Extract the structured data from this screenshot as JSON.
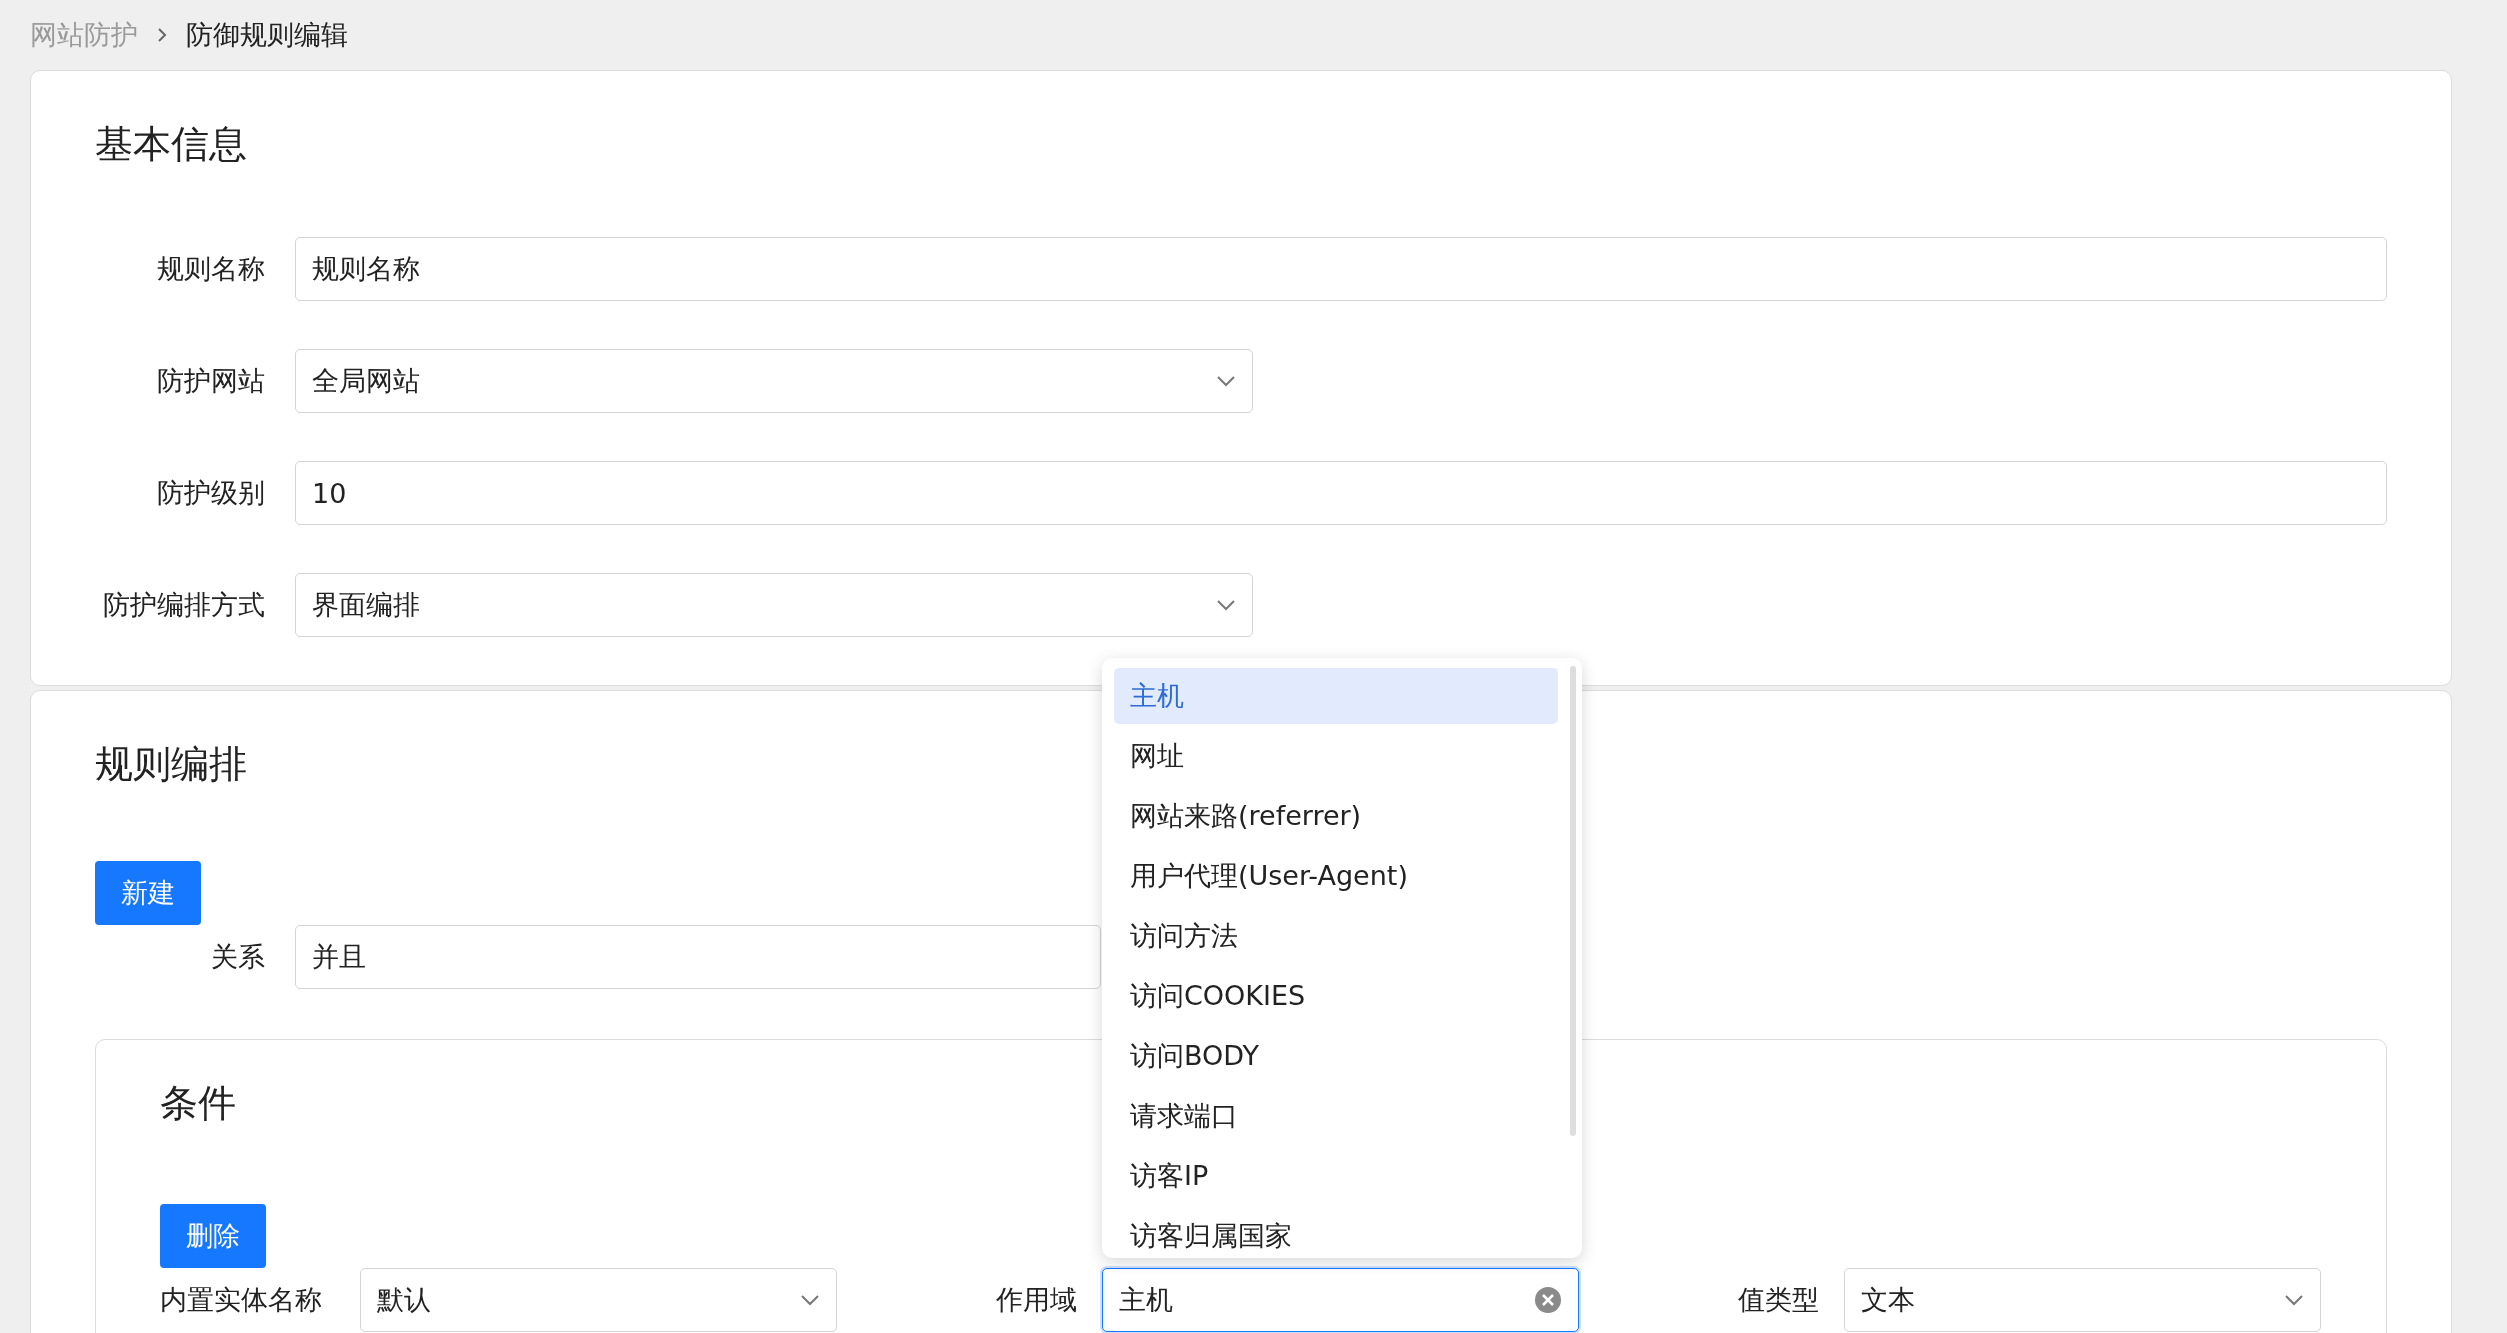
{
  "breadcrumb": [
    {
      "label": "网站防护",
      "current": false
    },
    {
      "label": "防御规则编辑",
      "current": true
    }
  ],
  "basic_info": {
    "title": "基本信息",
    "fields": [
      {
        "label": "规则名称",
        "kind": "input",
        "value": "规则名称"
      },
      {
        "label": "防护网站",
        "kind": "select",
        "value": "全局网站"
      },
      {
        "label": "防护级别",
        "kind": "input",
        "value": "10"
      },
      {
        "label": "防护编排方式",
        "kind": "select",
        "value": "界面编排"
      }
    ]
  },
  "rule_arrangement": {
    "title": "规则编排",
    "new_button": "新建",
    "relation": {
      "label": "关系",
      "value": "并且"
    },
    "condition": {
      "title": "条件",
      "delete_button": "删除",
      "fields": [
        {
          "label": "内置实体名称",
          "value": "默认",
          "focused": false
        },
        {
          "label": "作用域",
          "value": "主机",
          "focused": true
        },
        {
          "label": "值类型",
          "value": "文本",
          "focused": false
        }
      ]
    }
  },
  "dropdown_options": [
    {
      "label": "主机",
      "selected": true
    },
    {
      "label": "网址",
      "selected": false
    },
    {
      "label": "网站来路(referrer)",
      "selected": false
    },
    {
      "label": "用户代理(User-Agent)",
      "selected": false
    },
    {
      "label": "访问方法",
      "selected": false
    },
    {
      "label": "访问COOKIES",
      "selected": false
    },
    {
      "label": "访问BODY",
      "selected": false
    },
    {
      "label": "请求端口",
      "selected": false
    },
    {
      "label": "访客IP",
      "selected": false
    },
    {
      "label": "访客归属国家",
      "selected": false
    }
  ]
}
